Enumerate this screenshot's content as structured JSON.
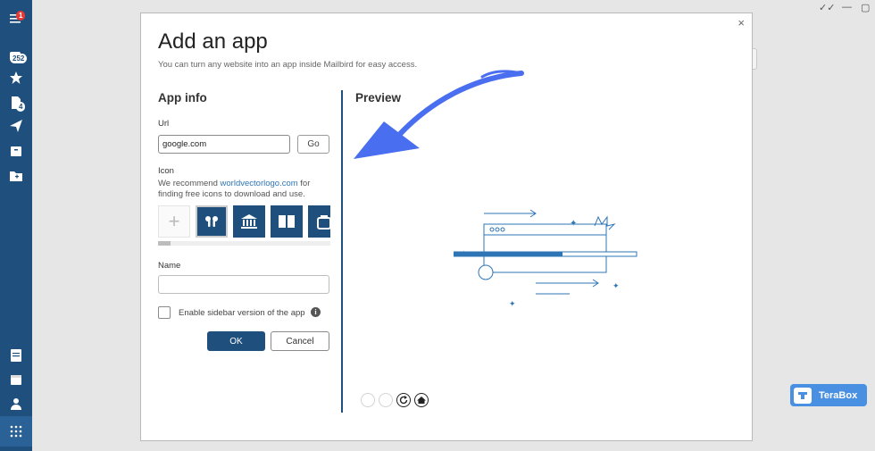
{
  "sidebar": {
    "menu_badge": "1",
    "inbox_badge": "252",
    "drafts_badge": "4"
  },
  "modal": {
    "title": "Add an app",
    "subtitle": "You can turn any website into an app inside Mailbird for easy access.",
    "close_label": "×"
  },
  "app_info": {
    "heading": "App info",
    "url_label": "Url",
    "url_value": "google.com",
    "go_label": "Go",
    "icon_label": "Icon",
    "recommend_prefix": "We recommend",
    "recommend_link": "worldvectorlogo.com",
    "recommend_suffix": "for finding free icons to download and use.",
    "add_icon_glyph": "+",
    "icon_options": [
      "airpods-icon",
      "bank-icon",
      "book-icon",
      "bag-icon"
    ],
    "name_label": "Name",
    "name_value": "",
    "sidebar_checkbox_label": "Enable sidebar version of the app",
    "sidebar_checkbox_checked": false,
    "ok_label": "OK",
    "cancel_label": "Cancel"
  },
  "preview": {
    "heading": "Preview"
  },
  "terabox": {
    "label": "TeraBox"
  },
  "colors": {
    "sidebar": "#1f4f7d",
    "accent": "#1f4f7d",
    "link": "#2e75b6",
    "annotation_arrow": "#4a6ef0",
    "terabox": "#4a90e2"
  }
}
